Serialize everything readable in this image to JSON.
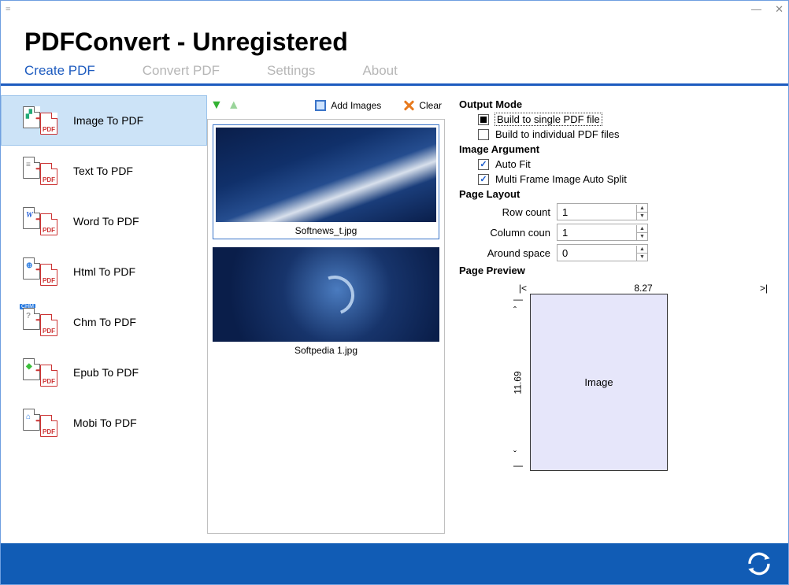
{
  "window": {
    "title": "="
  },
  "header": {
    "title": "PDFConvert - Unregistered"
  },
  "tabs": [
    {
      "label": "Create PDF",
      "active": true
    },
    {
      "label": "Convert PDF"
    },
    {
      "label": "Settings"
    },
    {
      "label": "About"
    }
  ],
  "sidebar": {
    "items": [
      {
        "label": "Image To PDF"
      },
      {
        "label": "Text To PDF"
      },
      {
        "label": "Word To PDF"
      },
      {
        "label": "Html To PDF"
      },
      {
        "label": "Chm To PDF"
      },
      {
        "label": "Epub To PDF"
      },
      {
        "label": "Mobi To PDF"
      }
    ]
  },
  "toolbar": {
    "add": "Add Images",
    "clear": "Clear"
  },
  "files": [
    {
      "name": "Softnews_t.jpg"
    },
    {
      "name": "Softpedia 1.jpg"
    }
  ],
  "options": {
    "output_mode": {
      "title": "Output Mode",
      "single": "Build to single PDF file",
      "individual": "Build to individual PDF files"
    },
    "image_arg": {
      "title": "Image Argument",
      "autofit": "Auto Fit",
      "multisplit": "Multi Frame Image Auto Split"
    },
    "page_layout": {
      "title": "Page Layout",
      "row_label": "Row count",
      "row_value": "1",
      "col_label": "Column coun",
      "col_value": "1",
      "sp_label": "Around space",
      "sp_value": "0"
    },
    "preview": {
      "title": "Page Preview",
      "width": "8.27",
      "height": "11.69",
      "cell": "Image"
    }
  }
}
